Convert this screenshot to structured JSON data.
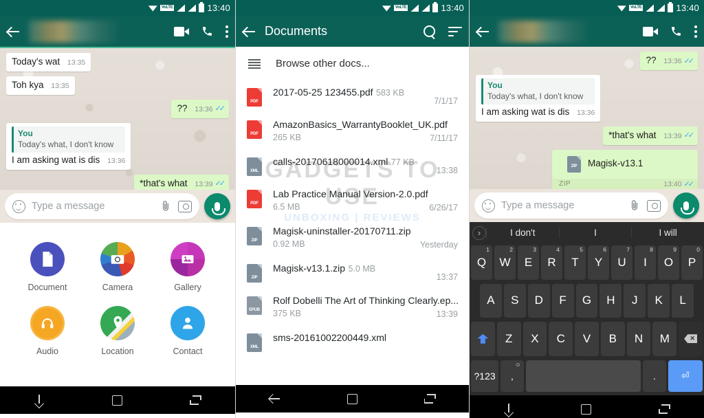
{
  "status_bar": {
    "time": "13:40",
    "volte_label": "VoLTE"
  },
  "panel1": {
    "appbar": {
      "contact_name_blurred": ""
    },
    "messages": [
      {
        "dir": "in",
        "text": "Today's wat",
        "time": "13:35"
      },
      {
        "dir": "in",
        "text": "Toh kya",
        "time": "13:35"
      },
      {
        "dir": "out",
        "text": "??",
        "time": "13:36",
        "ticks": "✓✓"
      },
      {
        "dir": "in",
        "quote_author": "You",
        "quote_text": "Today's what, I don't know",
        "text": "I am asking wat is dis",
        "time": "13:36"
      },
      {
        "dir": "out",
        "text": "*that's what",
        "time": "13:39",
        "ticks": "✓✓"
      }
    ],
    "input": {
      "placeholder": "Type a message"
    },
    "attachments": [
      {
        "label": "Document",
        "icon": "document-icon"
      },
      {
        "label": "Camera",
        "icon": "camera-icon"
      },
      {
        "label": "Gallery",
        "icon": "gallery-icon"
      },
      {
        "label": "Audio",
        "icon": "audio-icon"
      },
      {
        "label": "Location",
        "icon": "location-icon"
      },
      {
        "label": "Contact",
        "icon": "contact-icon"
      }
    ]
  },
  "panel2": {
    "appbar": {
      "title": "Documents",
      "search_icon": "search-icon",
      "sort_icon": "sort-icon"
    },
    "browse_label": "Browse other docs...",
    "files": [
      {
        "name": "2017-05-25 123455.pdf",
        "size": "583 KB",
        "date": "7/1/17",
        "type": "pdf"
      },
      {
        "name": "AmazonBasics_WarrantyBooklet_UK.pdf",
        "size": "265 KB",
        "date": "7/11/17",
        "type": "pdf"
      },
      {
        "name": "calls-20170618000014.xml",
        "size": "77 KB",
        "date": "13:38",
        "type": "xml"
      },
      {
        "name": "Lab Practice Manual Version-2.0.pdf",
        "size": "6.5 MB",
        "date": "6/26/17",
        "type": "pdf"
      },
      {
        "name": "Magisk-uninstaller-20170711.zip",
        "size": "0.92 MB",
        "date": "Yesterday",
        "type": "zip"
      },
      {
        "name": "Magisk-v13.1.zip",
        "size": "5.0 MB",
        "date": "13:37",
        "type": "zip"
      },
      {
        "name": "Rolf Dobelli The Art of Thinking Clearly.ep...",
        "size": "375 KB",
        "date": "13:39",
        "type": "epub"
      },
      {
        "name": "sms-20161002200449.xml",
        "size": "",
        "date": "",
        "type": "xml"
      }
    ],
    "watermark": {
      "line1": "GADGETS TO USE",
      "line2": "UNBOXING | REVIEWS"
    }
  },
  "panel3": {
    "appbar": {
      "contact_name_blurred": ""
    },
    "messages": [
      {
        "dir": "out",
        "text": "??",
        "time": "13:36",
        "ticks": "✓✓"
      },
      {
        "dir": "in",
        "quote_author": "You",
        "quote_text": "Today's what, I don't know",
        "text": "I am asking wat is dis",
        "time": "13:36"
      },
      {
        "dir": "out",
        "text": "*that's what",
        "time": "13:39",
        "ticks": "✓✓"
      }
    ],
    "doc_message": {
      "name": "Magisk-v13.1",
      "ext": "ZIP",
      "time": "13:40",
      "ticks": "✓✓",
      "type": "zip"
    },
    "input": {
      "placeholder": "Type a message"
    },
    "keyboard": {
      "suggestions": [
        "I don't",
        "I",
        "I will"
      ],
      "row1": [
        {
          "key": "Q",
          "num": "1"
        },
        {
          "key": "W",
          "num": "2"
        },
        {
          "key": "E",
          "num": "3"
        },
        {
          "key": "R",
          "num": "4"
        },
        {
          "key": "T",
          "num": "5"
        },
        {
          "key": "Y",
          "num": "6"
        },
        {
          "key": "U",
          "num": "7"
        },
        {
          "key": "I",
          "num": "8"
        },
        {
          "key": "O",
          "num": "9"
        },
        {
          "key": "P",
          "num": "0"
        }
      ],
      "row2": [
        "A",
        "S",
        "D",
        "F",
        "G",
        "H",
        "J",
        "K",
        "L"
      ],
      "row3": [
        "Z",
        "X",
        "C",
        "V",
        "B",
        "N",
        "M"
      ],
      "sym_key": "?123",
      "comma_key": ",",
      "period_key": ".",
      "space_key": "",
      "enter_key": "⏎",
      "shift_icon": "shift-icon",
      "delete_icon": "backspace-icon",
      "emoji_icon": "emoji-icon"
    }
  },
  "navbar": {
    "back": "back-icon",
    "home": "home-icon",
    "recents": "recents-icon",
    "down": "hide-keyboard-icon"
  }
}
